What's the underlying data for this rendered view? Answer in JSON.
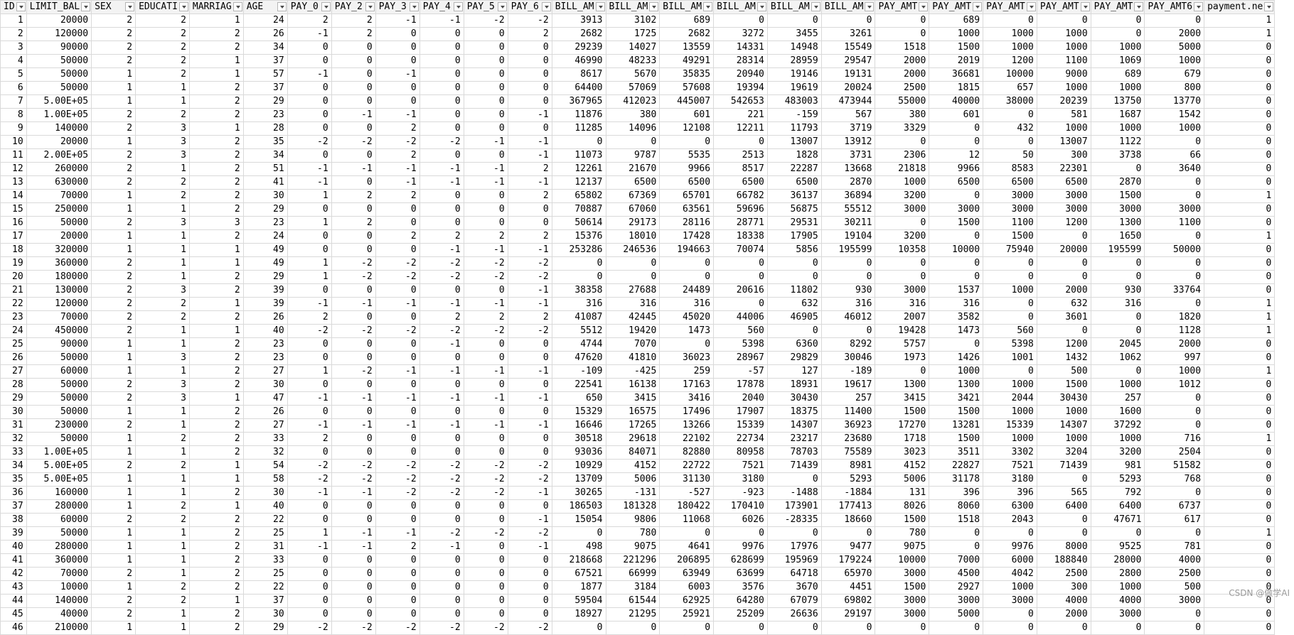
{
  "columns": [
    "ID",
    "LIMIT_BAL",
    "SEX",
    "EDUCATI",
    "MARRIAG",
    "AGE",
    "PAY_0",
    "PAY_2",
    "PAY_3",
    "PAY_4",
    "PAY_5",
    "PAY_6",
    "BILL_AM",
    "BILL_AM",
    "BILL_AM",
    "BILL_AM",
    "BILL_AM",
    "BILL_AM",
    "PAY_AMT",
    "PAY_AMT",
    "PAY_AMT",
    "PAY_AMT",
    "PAY_AMT",
    "PAY_AMT6",
    "payment.ne"
  ],
  "rows": [
    [
      "1",
      "20000",
      "2",
      "2",
      "1",
      "24",
      "2",
      "2",
      "-1",
      "-1",
      "-2",
      "-2",
      "3913",
      "3102",
      "689",
      "0",
      "0",
      "0",
      "0",
      "689",
      "0",
      "0",
      "0",
      "0",
      "1"
    ],
    [
      "2",
      "120000",
      "2",
      "2",
      "2",
      "26",
      "-1",
      "2",
      "0",
      "0",
      "0",
      "2",
      "2682",
      "1725",
      "2682",
      "3272",
      "3455",
      "3261",
      "0",
      "1000",
      "1000",
      "1000",
      "0",
      "2000",
      "1"
    ],
    [
      "3",
      "90000",
      "2",
      "2",
      "2",
      "34",
      "0",
      "0",
      "0",
      "0",
      "0",
      "0",
      "29239",
      "14027",
      "13559",
      "14331",
      "14948",
      "15549",
      "1518",
      "1500",
      "1000",
      "1000",
      "1000",
      "5000",
      "0"
    ],
    [
      "4",
      "50000",
      "2",
      "2",
      "1",
      "37",
      "0",
      "0",
      "0",
      "0",
      "0",
      "0",
      "46990",
      "48233",
      "49291",
      "28314",
      "28959",
      "29547",
      "2000",
      "2019",
      "1200",
      "1100",
      "1069",
      "1000",
      "0"
    ],
    [
      "5",
      "50000",
      "1",
      "2",
      "1",
      "57",
      "-1",
      "0",
      "-1",
      "0",
      "0",
      "0",
      "8617",
      "5670",
      "35835",
      "20940",
      "19146",
      "19131",
      "2000",
      "36681",
      "10000",
      "9000",
      "689",
      "679",
      "0"
    ],
    [
      "6",
      "50000",
      "1",
      "1",
      "2",
      "37",
      "0",
      "0",
      "0",
      "0",
      "0",
      "0",
      "64400",
      "57069",
      "57608",
      "19394",
      "19619",
      "20024",
      "2500",
      "1815",
      "657",
      "1000",
      "1000",
      "800",
      "0"
    ],
    [
      "7",
      "5.00E+05",
      "1",
      "1",
      "2",
      "29",
      "0",
      "0",
      "0",
      "0",
      "0",
      "0",
      "367965",
      "412023",
      "445007",
      "542653",
      "483003",
      "473944",
      "55000",
      "40000",
      "38000",
      "20239",
      "13750",
      "13770",
      "0"
    ],
    [
      "8",
      "1.00E+05",
      "2",
      "2",
      "2",
      "23",
      "0",
      "-1",
      "-1",
      "0",
      "0",
      "-1",
      "11876",
      "380",
      "601",
      "221",
      "-159",
      "567",
      "380",
      "601",
      "0",
      "581",
      "1687",
      "1542",
      "0"
    ],
    [
      "9",
      "140000",
      "2",
      "3",
      "1",
      "28",
      "0",
      "0",
      "2",
      "0",
      "0",
      "0",
      "11285",
      "14096",
      "12108",
      "12211",
      "11793",
      "3719",
      "3329",
      "0",
      "432",
      "1000",
      "1000",
      "1000",
      "0"
    ],
    [
      "10",
      "20000",
      "1",
      "3",
      "2",
      "35",
      "-2",
      "-2",
      "-2",
      "-2",
      "-1",
      "-1",
      "0",
      "0",
      "0",
      "0",
      "13007",
      "13912",
      "0",
      "0",
      "0",
      "13007",
      "1122",
      "0",
      "0"
    ],
    [
      "11",
      "2.00E+05",
      "2",
      "3",
      "2",
      "34",
      "0",
      "0",
      "2",
      "0",
      "0",
      "-1",
      "11073",
      "9787",
      "5535",
      "2513",
      "1828",
      "3731",
      "2306",
      "12",
      "50",
      "300",
      "3738",
      "66",
      "0"
    ],
    [
      "12",
      "260000",
      "2",
      "1",
      "2",
      "51",
      "-1",
      "-1",
      "-1",
      "-1",
      "-1",
      "2",
      "12261",
      "21670",
      "9966",
      "8517",
      "22287",
      "13668",
      "21818",
      "9966",
      "8583",
      "22301",
      "0",
      "3640",
      "0"
    ],
    [
      "13",
      "630000",
      "2",
      "2",
      "2",
      "41",
      "-1",
      "0",
      "-1",
      "-1",
      "-1",
      "-1",
      "12137",
      "6500",
      "6500",
      "6500",
      "6500",
      "2870",
      "1000",
      "6500",
      "6500",
      "6500",
      "2870",
      "0",
      "0"
    ],
    [
      "14",
      "70000",
      "1",
      "2",
      "2",
      "30",
      "1",
      "2",
      "2",
      "0",
      "0",
      "2",
      "65802",
      "67369",
      "65701",
      "66782",
      "36137",
      "36894",
      "3200",
      "0",
      "3000",
      "3000",
      "1500",
      "0",
      "1"
    ],
    [
      "15",
      "250000",
      "1",
      "1",
      "2",
      "29",
      "0",
      "0",
      "0",
      "0",
      "0",
      "0",
      "70887",
      "67060",
      "63561",
      "59696",
      "56875",
      "55512",
      "3000",
      "3000",
      "3000",
      "3000",
      "3000",
      "3000",
      "0"
    ],
    [
      "16",
      "50000",
      "2",
      "3",
      "3",
      "23",
      "1",
      "2",
      "0",
      "0",
      "0",
      "0",
      "50614",
      "29173",
      "28116",
      "28771",
      "29531",
      "30211",
      "0",
      "1500",
      "1100",
      "1200",
      "1300",
      "1100",
      "0"
    ],
    [
      "17",
      "20000",
      "1",
      "1",
      "2",
      "24",
      "0",
      "0",
      "2",
      "2",
      "2",
      "2",
      "15376",
      "18010",
      "17428",
      "18338",
      "17905",
      "19104",
      "3200",
      "0",
      "1500",
      "0",
      "1650",
      "0",
      "1"
    ],
    [
      "18",
      "320000",
      "1",
      "1",
      "1",
      "49",
      "0",
      "0",
      "0",
      "-1",
      "-1",
      "-1",
      "253286",
      "246536",
      "194663",
      "70074",
      "5856",
      "195599",
      "10358",
      "10000",
      "75940",
      "20000",
      "195599",
      "50000",
      "0"
    ],
    [
      "19",
      "360000",
      "2",
      "1",
      "1",
      "49",
      "1",
      "-2",
      "-2",
      "-2",
      "-2",
      "-2",
      "0",
      "0",
      "0",
      "0",
      "0",
      "0",
      "0",
      "0",
      "0",
      "0",
      "0",
      "0",
      "0"
    ],
    [
      "20",
      "180000",
      "2",
      "1",
      "2",
      "29",
      "1",
      "-2",
      "-2",
      "-2",
      "-2",
      "-2",
      "0",
      "0",
      "0",
      "0",
      "0",
      "0",
      "0",
      "0",
      "0",
      "0",
      "0",
      "0",
      "0"
    ],
    [
      "21",
      "130000",
      "2",
      "3",
      "2",
      "39",
      "0",
      "0",
      "0",
      "0",
      "0",
      "-1",
      "38358",
      "27688",
      "24489",
      "20616",
      "11802",
      "930",
      "3000",
      "1537",
      "1000",
      "2000",
      "930",
      "33764",
      "0"
    ],
    [
      "22",
      "120000",
      "2",
      "2",
      "1",
      "39",
      "-1",
      "-1",
      "-1",
      "-1",
      "-1",
      "-1",
      "316",
      "316",
      "316",
      "0",
      "632",
      "316",
      "316",
      "316",
      "0",
      "632",
      "316",
      "0",
      "1"
    ],
    [
      "23",
      "70000",
      "2",
      "2",
      "2",
      "26",
      "2",
      "0",
      "0",
      "2",
      "2",
      "2",
      "41087",
      "42445",
      "45020",
      "44006",
      "46905",
      "46012",
      "2007",
      "3582",
      "0",
      "3601",
      "0",
      "1820",
      "1"
    ],
    [
      "24",
      "450000",
      "2",
      "1",
      "1",
      "40",
      "-2",
      "-2",
      "-2",
      "-2",
      "-2",
      "-2",
      "5512",
      "19420",
      "1473",
      "560",
      "0",
      "0",
      "19428",
      "1473",
      "560",
      "0",
      "0",
      "1128",
      "1"
    ],
    [
      "25",
      "90000",
      "1",
      "1",
      "2",
      "23",
      "0",
      "0",
      "0",
      "-1",
      "0",
      "0",
      "4744",
      "7070",
      "0",
      "5398",
      "6360",
      "8292",
      "5757",
      "0",
      "5398",
      "1200",
      "2045",
      "2000",
      "0"
    ],
    [
      "26",
      "50000",
      "1",
      "3",
      "2",
      "23",
      "0",
      "0",
      "0",
      "0",
      "0",
      "0",
      "47620",
      "41810",
      "36023",
      "28967",
      "29829",
      "30046",
      "1973",
      "1426",
      "1001",
      "1432",
      "1062",
      "997",
      "0"
    ],
    [
      "27",
      "60000",
      "1",
      "1",
      "2",
      "27",
      "1",
      "-2",
      "-1",
      "-1",
      "-1",
      "-1",
      "-109",
      "-425",
      "259",
      "-57",
      "127",
      "-189",
      "0",
      "1000",
      "0",
      "500",
      "0",
      "1000",
      "1"
    ],
    [
      "28",
      "50000",
      "2",
      "3",
      "2",
      "30",
      "0",
      "0",
      "0",
      "0",
      "0",
      "0",
      "22541",
      "16138",
      "17163",
      "17878",
      "18931",
      "19617",
      "1300",
      "1300",
      "1000",
      "1500",
      "1000",
      "1012",
      "0"
    ],
    [
      "29",
      "50000",
      "2",
      "3",
      "1",
      "47",
      "-1",
      "-1",
      "-1",
      "-1",
      "-1",
      "-1",
      "650",
      "3415",
      "3416",
      "2040",
      "30430",
      "257",
      "3415",
      "3421",
      "2044",
      "30430",
      "257",
      "0",
      "0"
    ],
    [
      "30",
      "50000",
      "1",
      "1",
      "2",
      "26",
      "0",
      "0",
      "0",
      "0",
      "0",
      "0",
      "15329",
      "16575",
      "17496",
      "17907",
      "18375",
      "11400",
      "1500",
      "1500",
      "1000",
      "1000",
      "1600",
      "0",
      "0"
    ],
    [
      "31",
      "230000",
      "2",
      "1",
      "2",
      "27",
      "-1",
      "-1",
      "-1",
      "-1",
      "-1",
      "-1",
      "16646",
      "17265",
      "13266",
      "15339",
      "14307",
      "36923",
      "17270",
      "13281",
      "15339",
      "14307",
      "37292",
      "0",
      "0"
    ],
    [
      "32",
      "50000",
      "1",
      "2",
      "2",
      "33",
      "2",
      "0",
      "0",
      "0",
      "0",
      "0",
      "30518",
      "29618",
      "22102",
      "22734",
      "23217",
      "23680",
      "1718",
      "1500",
      "1000",
      "1000",
      "1000",
      "716",
      "1"
    ],
    [
      "33",
      "1.00E+05",
      "1",
      "1",
      "2",
      "32",
      "0",
      "0",
      "0",
      "0",
      "0",
      "0",
      "93036",
      "84071",
      "82880",
      "80958",
      "78703",
      "75589",
      "3023",
      "3511",
      "3302",
      "3204",
      "3200",
      "2504",
      "0"
    ],
    [
      "34",
      "5.00E+05",
      "2",
      "2",
      "1",
      "54",
      "-2",
      "-2",
      "-2",
      "-2",
      "-2",
      "-2",
      "10929",
      "4152",
      "22722",
      "7521",
      "71439",
      "8981",
      "4152",
      "22827",
      "7521",
      "71439",
      "981",
      "51582",
      "0"
    ],
    [
      "35",
      "5.00E+05",
      "1",
      "1",
      "1",
      "58",
      "-2",
      "-2",
      "-2",
      "-2",
      "-2",
      "-2",
      "13709",
      "5006",
      "31130",
      "3180",
      "0",
      "5293",
      "5006",
      "31178",
      "3180",
      "0",
      "5293",
      "768",
      "0"
    ],
    [
      "36",
      "160000",
      "1",
      "1",
      "2",
      "30",
      "-1",
      "-1",
      "-2",
      "-2",
      "-2",
      "-1",
      "30265",
      "-131",
      "-527",
      "-923",
      "-1488",
      "-1884",
      "131",
      "396",
      "396",
      "565",
      "792",
      "0",
      "0"
    ],
    [
      "37",
      "280000",
      "1",
      "2",
      "1",
      "40",
      "0",
      "0",
      "0",
      "0",
      "0",
      "0",
      "186503",
      "181328",
      "180422",
      "170410",
      "173901",
      "177413",
      "8026",
      "8060",
      "6300",
      "6400",
      "6400",
      "6737",
      "0"
    ],
    [
      "38",
      "60000",
      "2",
      "2",
      "2",
      "22",
      "0",
      "0",
      "0",
      "0",
      "0",
      "-1",
      "15054",
      "9806",
      "11068",
      "6026",
      "-28335",
      "18660",
      "1500",
      "1518",
      "2043",
      "0",
      "47671",
      "617",
      "0"
    ],
    [
      "39",
      "50000",
      "1",
      "1",
      "2",
      "25",
      "1",
      "-1",
      "-1",
      "-2",
      "-2",
      "-2",
      "0",
      "780",
      "0",
      "0",
      "0",
      "0",
      "780",
      "0",
      "0",
      "0",
      "0",
      "0",
      "1"
    ],
    [
      "40",
      "280000",
      "1",
      "1",
      "2",
      "31",
      "-1",
      "-1",
      "2",
      "-1",
      "0",
      "-1",
      "498",
      "9075",
      "4641",
      "9976",
      "17976",
      "9477",
      "9075",
      "0",
      "9976",
      "8000",
      "9525",
      "781",
      "0"
    ],
    [
      "41",
      "360000",
      "1",
      "1",
      "2",
      "33",
      "0",
      "0",
      "0",
      "0",
      "0",
      "0",
      "218668",
      "221296",
      "206895",
      "628699",
      "195969",
      "179224",
      "10000",
      "7000",
      "6000",
      "188840",
      "28000",
      "4000",
      "0"
    ],
    [
      "42",
      "70000",
      "2",
      "1",
      "2",
      "25",
      "0",
      "0",
      "0",
      "0",
      "0",
      "0",
      "67521",
      "66999",
      "63949",
      "63699",
      "64718",
      "65970",
      "3000",
      "4500",
      "4042",
      "2500",
      "2800",
      "2500",
      "0"
    ],
    [
      "43",
      "10000",
      "1",
      "2",
      "2",
      "22",
      "0",
      "0",
      "0",
      "0",
      "0",
      "0",
      "1877",
      "3184",
      "6003",
      "3576",
      "3670",
      "4451",
      "1500",
      "2927",
      "1000",
      "300",
      "1000",
      "500",
      "0"
    ],
    [
      "44",
      "140000",
      "2",
      "2",
      "1",
      "37",
      "0",
      "0",
      "0",
      "0",
      "0",
      "0",
      "59504",
      "61544",
      "62925",
      "64280",
      "67079",
      "69802",
      "3000",
      "3000",
      "3000",
      "4000",
      "4000",
      "3000",
      "0"
    ],
    [
      "45",
      "40000",
      "2",
      "1",
      "2",
      "30",
      "0",
      "0",
      "0",
      "0",
      "0",
      "0",
      "18927",
      "21295",
      "25921",
      "25209",
      "26636",
      "29197",
      "3000",
      "5000",
      "0",
      "2000",
      "3000",
      "0",
      "0"
    ],
    [
      "46",
      "210000",
      "1",
      "1",
      "2",
      "29",
      "-2",
      "-2",
      "-2",
      "-2",
      "-2",
      "-2",
      "0",
      "0",
      "0",
      "0",
      "0",
      "0",
      "0",
      "0",
      "0",
      "0",
      "0",
      "0",
      "0"
    ]
  ],
  "watermark": "CSDN @做学AI"
}
